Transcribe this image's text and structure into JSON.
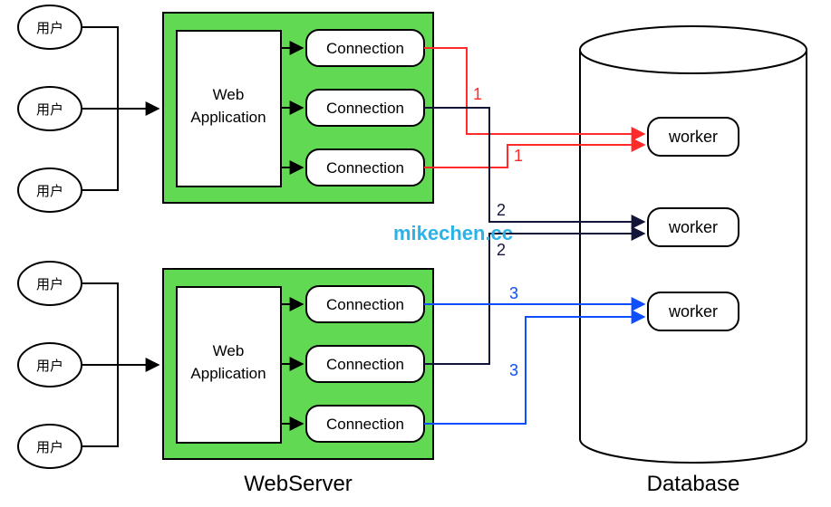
{
  "users": {
    "top": [
      {
        "label": "用户"
      },
      {
        "label": "用户"
      },
      {
        "label": "用户"
      }
    ],
    "bottom": [
      {
        "label": "用户"
      },
      {
        "label": "用户"
      },
      {
        "label": "用户"
      }
    ]
  },
  "webservers": {
    "top": {
      "app_label_line1": "Web",
      "app_label_line2": "Application",
      "connections": [
        {
          "label": "Connection"
        },
        {
          "label": "Connection"
        },
        {
          "label": "Connection"
        }
      ]
    },
    "bottom": {
      "app_label_line1": "Web",
      "app_label_line2": "Application",
      "connections": [
        {
          "label": "Connection"
        },
        {
          "label": "Connection"
        },
        {
          "label": "Connection"
        }
      ]
    }
  },
  "database": {
    "workers": [
      {
        "label": "worker"
      },
      {
        "label": "worker"
      },
      {
        "label": "worker"
      }
    ]
  },
  "labels": {
    "webserver": "WebServer",
    "database": "Database"
  },
  "link_labels": {
    "red_a": "1",
    "red_b": "1",
    "navy_a": "2",
    "navy_b": "2",
    "blue_a": "3",
    "blue_b": "3"
  },
  "watermark": "mikechen.cc",
  "colors": {
    "green": "#62d952",
    "red": "#ff2a2a",
    "navy": "#121538",
    "blue": "#0d4fff",
    "black": "#000000",
    "white": "#ffffff"
  }
}
